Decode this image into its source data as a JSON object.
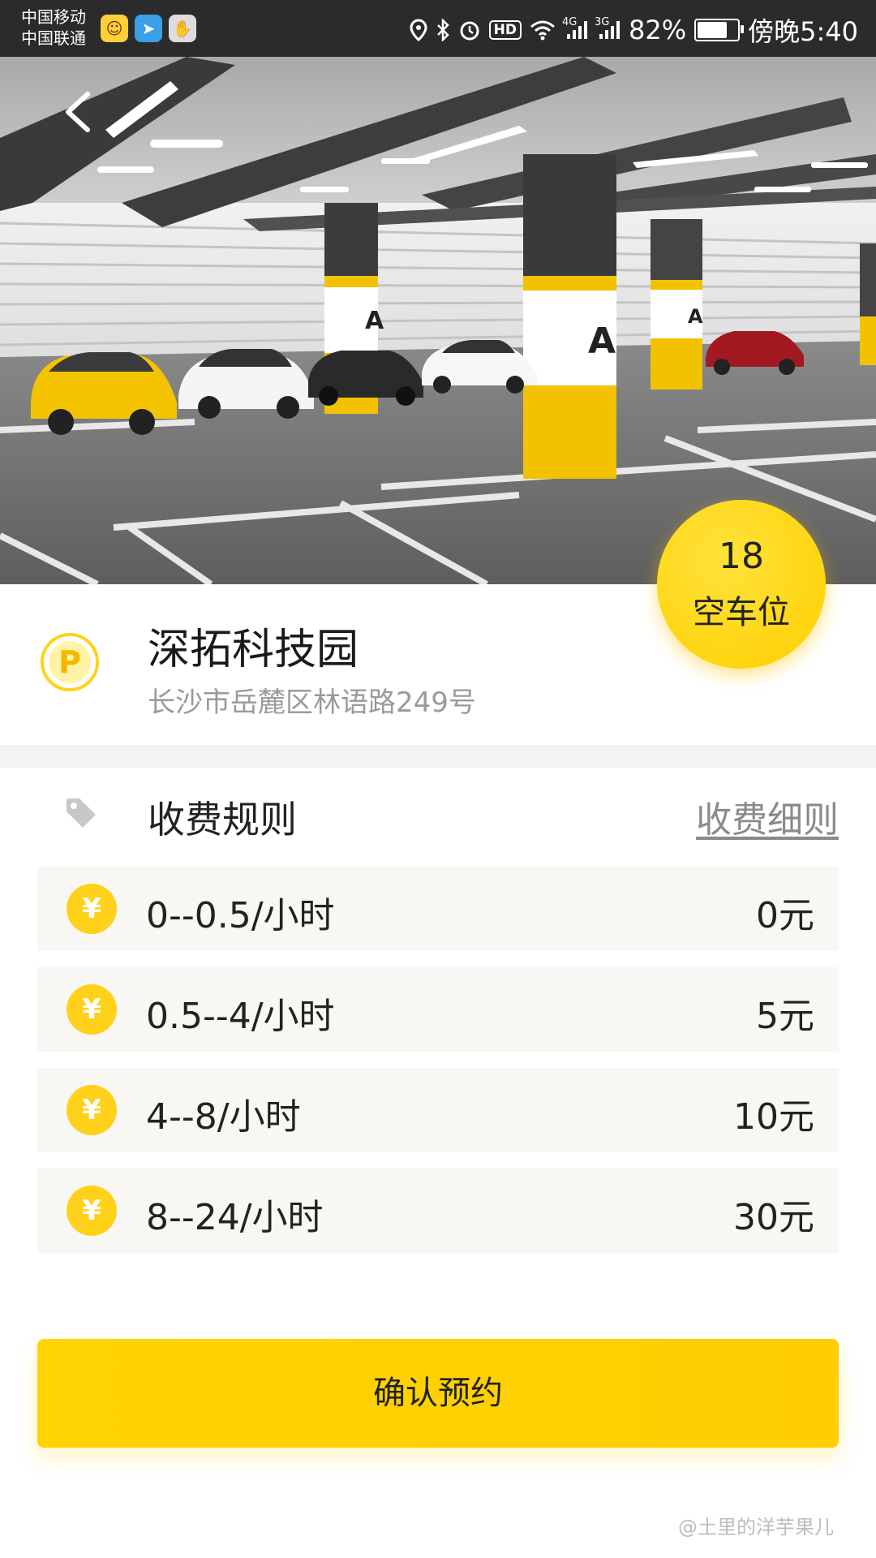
{
  "status_bar": {
    "carrier_1": "中国移动",
    "carrier_2": "中国联通",
    "app_icons": [
      "chat-app-icon",
      "telegram-icon",
      "hand-icon"
    ],
    "icons": [
      "location-icon",
      "bluetooth-icon",
      "alarm-icon",
      "hd-icon",
      "wifi-icon",
      "signal-4g-icon",
      "signal-3g-icon"
    ],
    "hd": "HD",
    "network_1": "4G",
    "network_2": "3G",
    "battery": "82%",
    "battery_level": 0.82,
    "time": "傍晚5:40"
  },
  "hero": {
    "pillar_label": "A"
  },
  "availability": {
    "count": "18",
    "label": "空车位"
  },
  "lot": {
    "icon_letter": "P",
    "name": "深拓科技园",
    "address": "长沙市岳麓区林语路249号"
  },
  "fees": {
    "title": "收费规则",
    "detail_link": "收费细则",
    "currency_symbol": "¥",
    "rows": [
      {
        "range": "0--0.5/小时",
        "price": "0元"
      },
      {
        "range": "0.5--4/小时",
        "price": "5元"
      },
      {
        "range": "4--8/小时",
        "price": "10元"
      },
      {
        "range": "8--24/小时",
        "price": "30元"
      }
    ]
  },
  "actions": {
    "confirm": "确认预约"
  },
  "watermark": "@土里的洋芋果儿",
  "colors": {
    "accent": "#FFD000",
    "row_background": "#F9F7F3",
    "secondary_text": "#9A9A9A"
  }
}
